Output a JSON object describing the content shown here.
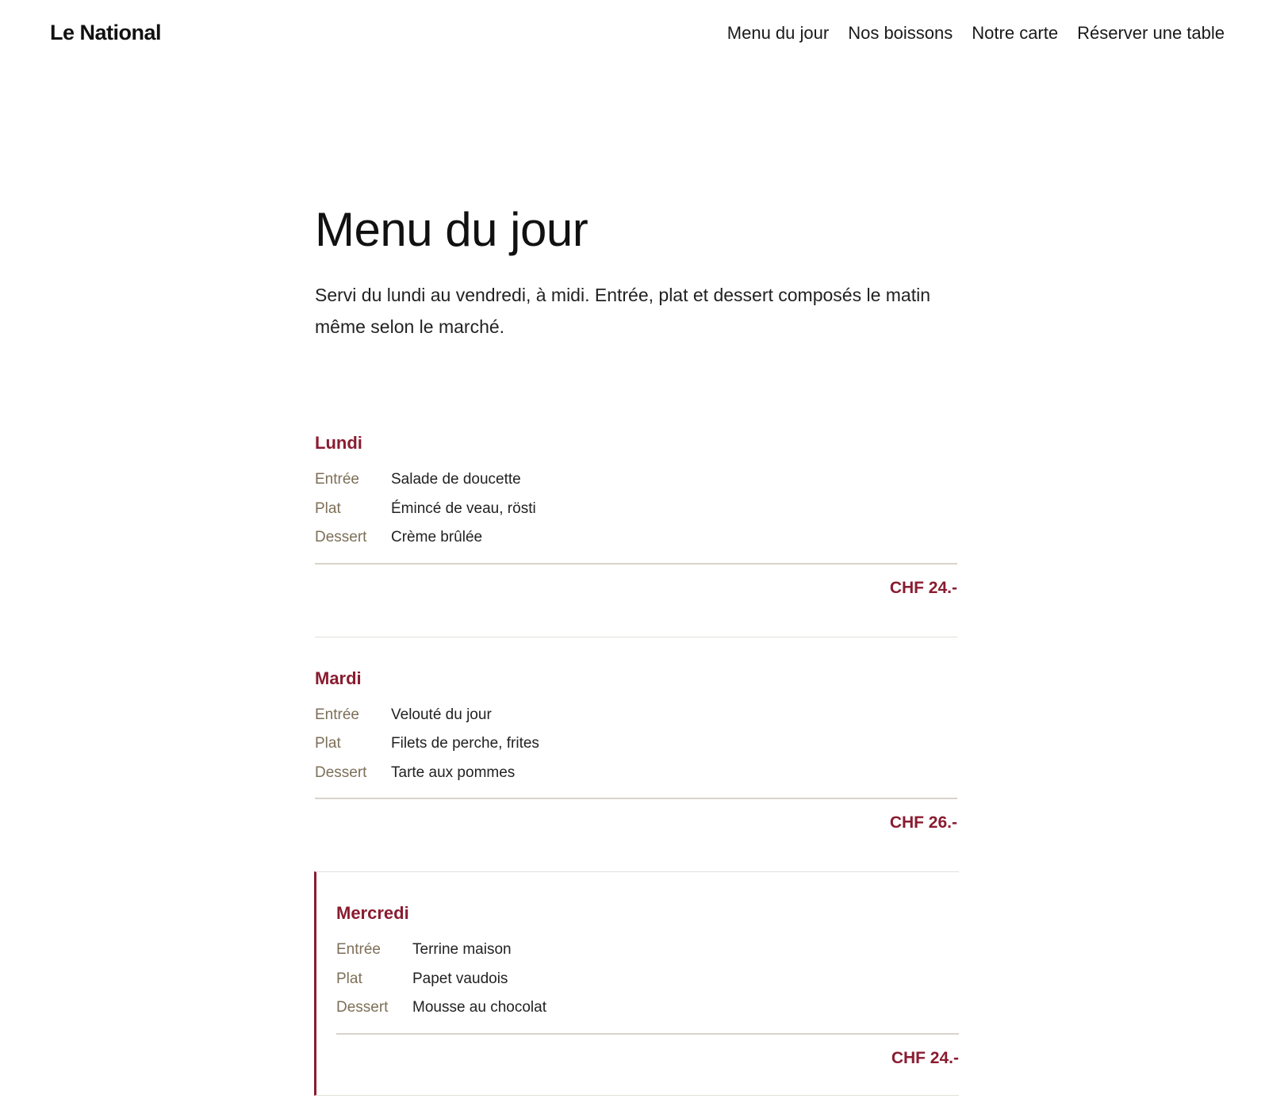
{
  "header": {
    "brand": "Le National",
    "nav": [
      {
        "label": "Menu du jour"
      },
      {
        "label": "Nos boissons"
      },
      {
        "label": "Notre carte"
      },
      {
        "label": "Réserver une table"
      }
    ]
  },
  "main": {
    "title": "Menu du jour",
    "intro": "Servi du lundi au vendredi, à midi. Entrée, plat et dessert composés le matin même selon le marché."
  },
  "days": [
    {
      "name": "Lundi",
      "courses": [
        {
          "label": "Entrée",
          "dish": "Salade de doucette"
        },
        {
          "label": "Plat",
          "dish": "Émincé de veau, rösti"
        },
        {
          "label": "Dessert",
          "dish": "Crème brûlée"
        }
      ],
      "price": "CHF 24.-"
    },
    {
      "name": "Mardi",
      "courses": [
        {
          "label": "Entrée",
          "dish": "Velouté du jour"
        },
        {
          "label": "Plat",
          "dish": "Filets de perche, frites"
        },
        {
          "label": "Dessert",
          "dish": "Tarte aux pommes"
        }
      ],
      "price": "CHF 26.-"
    },
    {
      "name": "Mercredi",
      "highlighted": true,
      "courses": [
        {
          "label": "Entrée",
          "dish": "Terrine maison"
        },
        {
          "label": "Plat",
          "dish": "Papet vaudois"
        },
        {
          "label": "Dessert",
          "dish": "Mousse au chocolat"
        }
      ],
      "price": "CHF 24.-"
    }
  ],
  "colors": {
    "accent": "#8a1c30",
    "course_label": "#7d6f58",
    "divider": "#d9d3ca"
  }
}
